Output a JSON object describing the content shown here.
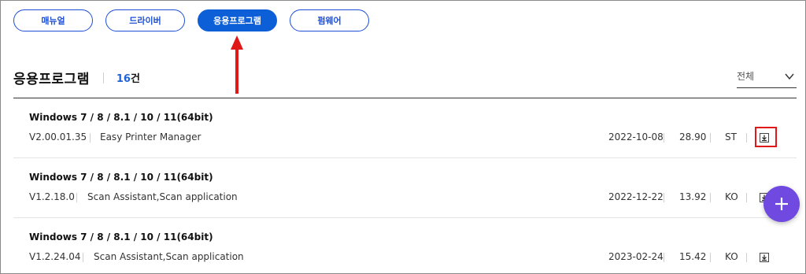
{
  "tabs": [
    {
      "label": "매뉴얼",
      "active": false
    },
    {
      "label": "드라이버",
      "active": false
    },
    {
      "label": "응용프로그램",
      "active": true
    },
    {
      "label": "펌웨어",
      "active": false
    }
  ],
  "section": {
    "title": "응용프로그램",
    "count_number": "16",
    "count_unit": "건"
  },
  "filter": {
    "selected": "전체"
  },
  "rows": [
    {
      "os": "Windows 7 / 8 / 8.1 / 10 / 11(64bit)",
      "version": "V2.00.01.35",
      "description": "Easy Printer Manager",
      "date": "2022-10-08",
      "size": "28.90",
      "lang": "ST"
    },
    {
      "os": "Windows 7 / 8 / 8.1 / 10 / 11(64bit)",
      "version": "V1.2.18.0",
      "description": "Scan Assistant,Scan application",
      "date": "2022-12-22",
      "size": "13.92",
      "lang": "KO"
    },
    {
      "os": "Windows 7 / 8 / 8.1 / 10 / 11(64bit)",
      "version": "V1.2.24.04",
      "description": "Scan Assistant,Scan application",
      "date": "2023-02-24",
      "size": "15.42",
      "lang": "KO"
    }
  ],
  "colors": {
    "accent": "#0d5fd7",
    "fab": "#6f49e0",
    "highlight": "#e01818"
  },
  "icons": {
    "download": "download-icon",
    "fab": "plus-icon",
    "filter": "chevron-down-icon"
  }
}
